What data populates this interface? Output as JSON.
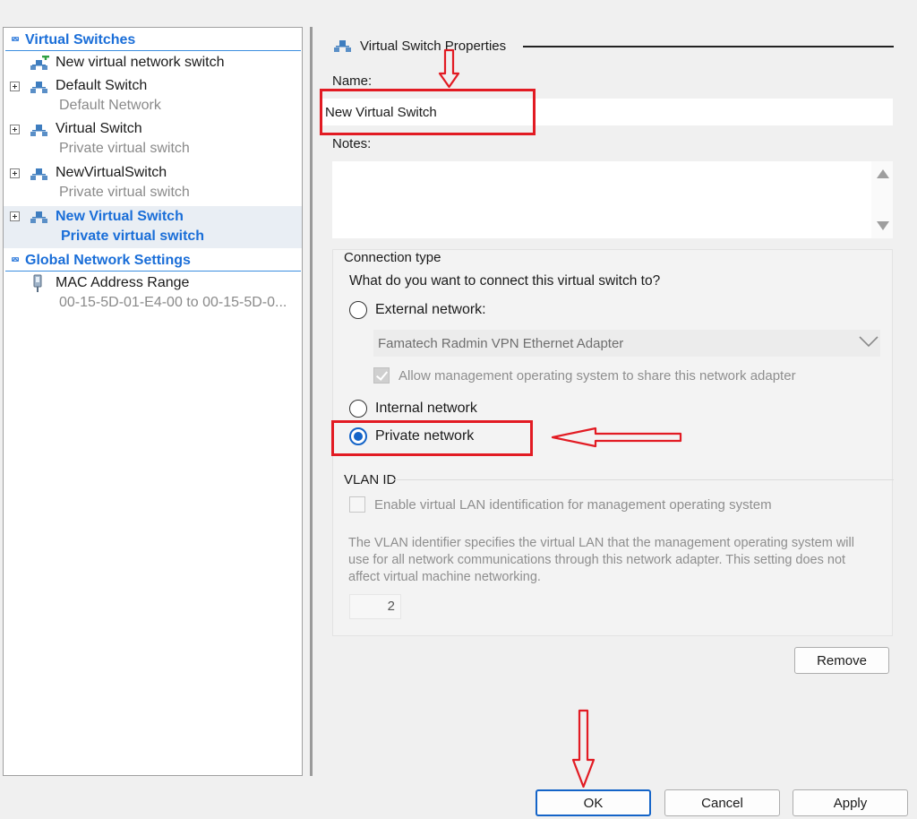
{
  "tree": {
    "virtual_switches_header": "Virtual Switches",
    "items": [
      {
        "label": "New virtual network switch",
        "sub": ""
      },
      {
        "label": "Default Switch",
        "sub": "Default Network"
      },
      {
        "label": "Virtual Switch",
        "sub": "Private virtual switch"
      },
      {
        "label": "NewVirtualSwitch",
        "sub": "Private virtual switch"
      },
      {
        "label": "New Virtual Switch",
        "sub": "Private virtual switch"
      }
    ],
    "global_header": "Global Network Settings",
    "mac_label": "MAC Address Range",
    "mac_value": "00-15-5D-01-E4-00 to 00-15-5D-0..."
  },
  "props": {
    "group_title": "Virtual Switch Properties",
    "name_label": "Name:",
    "name_value": "New Virtual Switch",
    "notes_label": "Notes:",
    "connection_type_label": "Connection type",
    "connection_question": "What do you want to connect this virtual switch to?",
    "external_label": "External network:",
    "adapter_value": "Famatech Radmin VPN Ethernet Adapter",
    "allow_mgmt_label": "Allow management operating system to share this network adapter",
    "internal_label": "Internal network",
    "private_label": "Private network",
    "selected_connection": "Private network",
    "vlan_title": "VLAN ID",
    "vlan_enable_label": "Enable virtual LAN identification for management operating system",
    "vlan_desc": "The VLAN identifier specifies the virtual LAN that the management operating system will use for all network communications through this network adapter. This setting does not affect virtual machine networking.",
    "vlan_value": "2",
    "remove_label": "Remove"
  },
  "footer": {
    "ok_label": "OK",
    "cancel_label": "Cancel",
    "apply_label": "Apply"
  },
  "colors": {
    "accent": "#1a6ed8",
    "annotation": "#e21b23"
  }
}
